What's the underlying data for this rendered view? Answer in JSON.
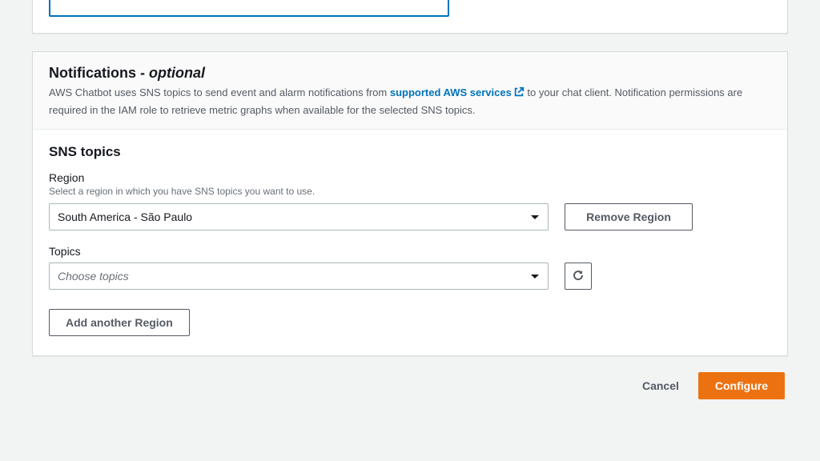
{
  "notifications": {
    "title_prefix": "Notifications - ",
    "title_optional": "optional",
    "desc_part1": "AWS Chatbot uses SNS topics to send event and alarm notifications from ",
    "link_text": "supported AWS services",
    "desc_part2": " to your chat client. Notification permissions are required in the IAM role to retrieve metric graphs when available for the selected SNS topics."
  },
  "sns": {
    "section_title": "SNS topics",
    "region_label": "Region",
    "region_hint": "Select a region in which you have SNS topics you want to use.",
    "region_value": "South America - São Paulo",
    "remove_region_label": "Remove Region",
    "topics_label": "Topics",
    "topics_placeholder": "Choose topics",
    "add_region_label": "Add another Region"
  },
  "footer": {
    "cancel": "Cancel",
    "configure": "Configure"
  }
}
